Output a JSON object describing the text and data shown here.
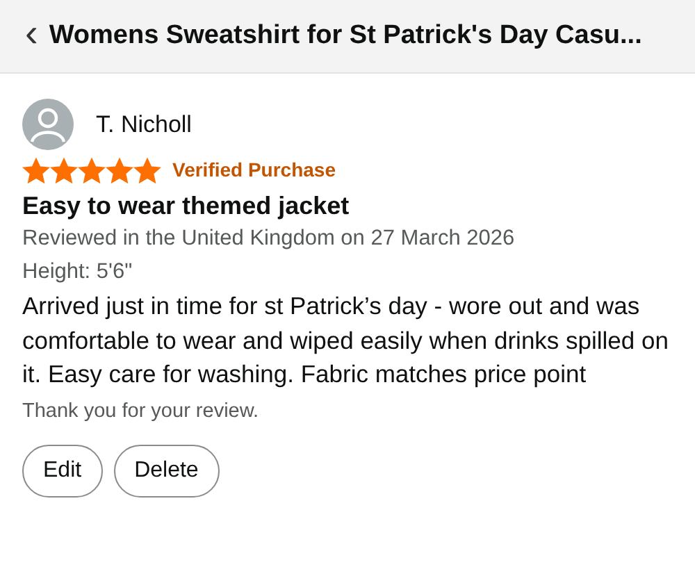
{
  "header": {
    "back_icon": "‹",
    "title": "Womens Sweatshirt for St Patrick's Day Casu..."
  },
  "review": {
    "author": "T. Nicholl",
    "stars": 5,
    "badge": "Verified Purchase",
    "title": "Easy to wear themed jacket",
    "meta": [
      "Reviewed in the United Kingdom on 27 March 2026",
      "Height: 5'6\""
    ],
    "body": "Arrived just in time for st Patrick’s day - wore out and was comfortable to wear and wiped easily when drinks spilled on it. Easy care for washing. Fabric matches price point",
    "thanks": "Thank you for your review."
  },
  "buttons": [
    "Edit",
    "Delete"
  ]
}
